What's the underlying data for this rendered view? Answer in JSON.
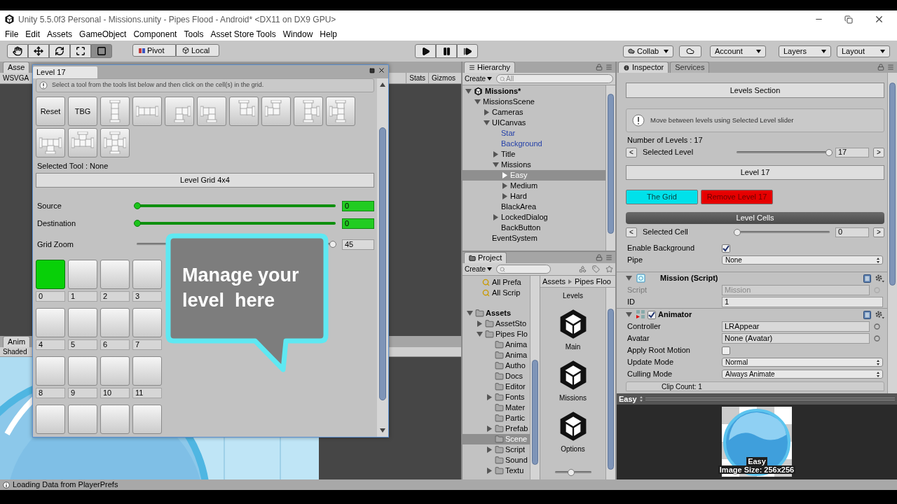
{
  "window": {
    "title": "Unity 5.5.0f3 Personal - Missions.unity - Pipes Flood - Android* <DX11 on DX9 GPU>"
  },
  "menu": [
    "File",
    "Edit",
    "Assets",
    "GameObject",
    "Component",
    "Tools",
    "Asset Store Tools",
    "Window",
    "Help"
  ],
  "toolbar": {
    "tools": [
      {
        "kind": "hand",
        "selected": false
      },
      {
        "kind": "move",
        "selected": false
      },
      {
        "kind": "rotate",
        "selected": false
      },
      {
        "kind": "scale",
        "selected": false
      },
      {
        "kind": "rect",
        "selected": true
      }
    ],
    "handles": [
      {
        "kind": "pivot",
        "label": "Pivot"
      },
      {
        "kind": "local",
        "label": "Local"
      }
    ],
    "playback": [
      {
        "kind": "play",
        "selected": false
      },
      {
        "kind": "pause",
        "selected": false
      },
      {
        "kind": "step",
        "selected": false
      }
    ],
    "right": [
      {
        "kind": "collab",
        "label": "Collab"
      },
      {
        "kind": "cloud"
      },
      {
        "kind": "dropdown",
        "label": "Account"
      },
      {
        "kind": "dropdown",
        "label": "Layers"
      },
      {
        "kind": "dropdown",
        "label": "Layout"
      }
    ]
  },
  "scene_panel": {
    "tab": "Asse",
    "resolution": "WSVGA",
    "buttons": [
      "Stats",
      "Gizmos"
    ]
  },
  "animation_panel": {
    "tab": "Anim",
    "mode": "Shaded"
  },
  "level_window": {
    "tab": "Level 17",
    "help": "Select a tool from the tools list below and then click on the cell(s) in the grid.",
    "tools": [
      {
        "kind": "text",
        "label": "Reset"
      },
      {
        "kind": "text",
        "label": "TBG"
      },
      {
        "kind": "pipe",
        "north": true,
        "east": false,
        "south": true,
        "west": false
      },
      {
        "kind": "pipe",
        "north": false,
        "east": true,
        "south": false,
        "west": true
      },
      {
        "kind": "pipe",
        "north": false,
        "east": true,
        "south": true,
        "west": false
      },
      {
        "kind": "pipe",
        "north": false,
        "east": false,
        "south": true,
        "west": true
      },
      {
        "kind": "pipe",
        "north": true,
        "east": true,
        "south": false,
        "west": false
      },
      {
        "kind": "pipe",
        "north": true,
        "east": false,
        "south": false,
        "west": true
      },
      {
        "kind": "pipe",
        "north": true,
        "east": true,
        "south": true,
        "west": false
      },
      {
        "kind": "pipe",
        "north": true,
        "east": false,
        "south": true,
        "west": true
      },
      {
        "kind": "pipe",
        "north": false,
        "east": true,
        "south": true,
        "west": true
      },
      {
        "kind": "pipe",
        "north": true,
        "east": true,
        "south": false,
        "west": true
      },
      {
        "kind": "pipe",
        "north": true,
        "east": true,
        "south": true,
        "west": true
      }
    ],
    "selected_tool": "Selected Tool : None",
    "grid_header": "Level Grid 4x4",
    "sliders": [
      {
        "label": "Source",
        "level": 0,
        "value": "0",
        "highlight": true
      },
      {
        "label": "Destination",
        "level": 0,
        "value": "0",
        "highlight": true
      },
      {
        "label": "Grid Zoom",
        "level": 0.99,
        "value": "45",
        "highlight": false
      }
    ],
    "cells": [
      {
        "label": "0",
        "filled": true
      },
      {
        "label": "1",
        "filled": false
      },
      {
        "label": "2",
        "filled": false
      },
      {
        "label": "3",
        "filled": false
      },
      {
        "label": "4",
        "filled": false
      },
      {
        "label": "5",
        "filled": false
      },
      {
        "label": "6",
        "filled": false
      },
      {
        "label": "7",
        "filled": false
      },
      {
        "label": "8",
        "filled": false
      },
      {
        "label": "9",
        "filled": false
      },
      {
        "label": "10",
        "filled": false
      },
      {
        "label": "11",
        "filled": false
      },
      {
        "filled": false
      },
      {
        "filled": false
      },
      {
        "filled": false
      },
      {
        "filled": false
      }
    ]
  },
  "callout": {
    "text": "Manage your level  here"
  },
  "hierarchy": {
    "tab": "Hierarchy",
    "create": "Create",
    "search_placeholder": "All",
    "tree": [
      {
        "name": "Missions*",
        "kind": "scene",
        "expanded": true,
        "selected": false,
        "prefab": false,
        "children": [
          {
            "name": "MissionsScene",
            "expanded": true,
            "selected": false,
            "prefab": false,
            "children": [
              {
                "name": "Cameras",
                "expanded": false,
                "selected": false,
                "prefab": false
              },
              {
                "name": "UICanvas",
                "expanded": true,
                "selected": false,
                "prefab": false,
                "children": [
                  {
                    "name": "Star",
                    "selected": false,
                    "prefab": true
                  },
                  {
                    "name": "Background",
                    "selected": false,
                    "prefab": true
                  },
                  {
                    "name": "Title",
                    "expanded": false,
                    "selected": false,
                    "prefab": false
                  },
                  {
                    "name": "Missions",
                    "expanded": true,
                    "selected": false,
                    "prefab": false,
                    "children": [
                      {
                        "name": "Easy",
                        "expanded": false,
                        "selected": true,
                        "prefab": false
                      },
                      {
                        "name": "Medium",
                        "expanded": false,
                        "selected": false,
                        "prefab": false
                      },
                      {
                        "name": "Hard",
                        "expanded": false,
                        "selected": false,
                        "prefab": false
                      }
                    ]
                  },
                  {
                    "name": "BlackArea",
                    "selected": false,
                    "prefab": false
                  },
                  {
                    "name": "LockedDialog",
                    "expanded": false,
                    "selected": false,
                    "prefab": false
                  },
                  {
                    "name": "BackButton",
                    "selected": false,
                    "prefab": false
                  }
                ]
              },
              {
                "name": "EventSystem",
                "selected": false,
                "prefab": false
              }
            ]
          }
        ]
      }
    ]
  },
  "project": {
    "tab": "Project",
    "create": "Create",
    "favorites": [
      "All Prefa",
      "All Scrip"
    ],
    "tree": [
      {
        "name": "Assets",
        "expanded": true,
        "selected": false,
        "children": [
          {
            "name": "AssetSto",
            "expanded": false,
            "selected": false
          },
          {
            "name": "Pipes Flo",
            "expanded": true,
            "selected": false,
            "children": [
              {
                "name": "Anima",
                "selected": false
              },
              {
                "name": "Anima",
                "selected": false
              },
              {
                "name": "Autho",
                "selected": false
              },
              {
                "name": "Docs",
                "selected": false
              },
              {
                "name": "Editor",
                "selected": false
              },
              {
                "name": "Fonts",
                "expanded": false,
                "selected": false
              },
              {
                "name": "Mater",
                "selected": false
              },
              {
                "name": "Partic",
                "selected": false
              },
              {
                "name": "Prefab",
                "expanded": false,
                "selected": false
              },
              {
                "name": "Scene",
                "selected": true
              },
              {
                "name": "Script",
                "expanded": false,
                "selected": false
              },
              {
                "name": "Sound",
                "selected": false
              },
              {
                "name": "Textu",
                "expanded": false,
                "selected": false
              }
            ]
          }
        ]
      }
    ],
    "breadcrumb": [
      "Assets",
      "Pipes Floo"
    ],
    "assets": [
      {
        "label": "Levels",
        "kind": "cut"
      },
      {
        "label": "Main",
        "kind": "scene"
      },
      {
        "label": "Missions",
        "kind": "scene"
      },
      {
        "label": "Options",
        "kind": "scene"
      }
    ]
  },
  "inspector": {
    "tabs": [
      {
        "label": "Inspector",
        "selected": true
      },
      {
        "label": "Services",
        "selected": false
      }
    ],
    "section_header": "Levels Section",
    "help": "Move between levels using Selected Level slider",
    "levels_count": "Number of Levels : 17",
    "selected_level": {
      "prev": "<",
      "label": "Selected Level",
      "level": 1,
      "value": "17",
      "next": ">"
    },
    "level_header": "Level 17",
    "actions": [
      {
        "label": "The Grid",
        "color": "#00e1ea"
      },
      {
        "label": "Remove Level 17",
        "color": "#e60000"
      }
    ],
    "cells_header": "Level Cells",
    "selected_cell": {
      "prev": "<",
      "label": "Selected Cell",
      "level": 0,
      "value": "0",
      "next": ">"
    },
    "cell_fields": [
      {
        "kind": "checkbox",
        "label": "Enable Background",
        "checked": true
      },
      {
        "kind": "dropdown",
        "label": "Pipe",
        "value": "None"
      }
    ],
    "components": [
      {
        "title": "Mission (Script)",
        "kind": "script",
        "expanded": true,
        "fields": [
          {
            "kind": "object",
            "label": "Script",
            "value": "Mission",
            "disabled": true
          },
          {
            "kind": "text",
            "label": "ID",
            "value": "1",
            "disabled": false
          }
        ]
      },
      {
        "title": "Animator",
        "kind": "animator",
        "expanded": true,
        "enabled": true,
        "fields": [
          {
            "kind": "object",
            "label": "Controller",
            "value": "LRAppear",
            "disabled": false
          },
          {
            "kind": "object",
            "label": "Avatar",
            "value": "None (Avatar)",
            "disabled": false
          },
          {
            "kind": "checkbox",
            "label": "Apply Root Motion",
            "checked": false
          },
          {
            "kind": "dropdown",
            "label": "Update Mode",
            "value": "Normal"
          },
          {
            "kind": "dropdown",
            "label": "Culling Mode",
            "value": "Always Animate"
          }
        ],
        "note": "Clip Count: 1"
      }
    ],
    "preview": {
      "title": "Easy",
      "name": "Easy",
      "size": "Image Size: 256x256"
    }
  },
  "status_bar": {
    "text": "Loading Data from PlayerPrefs"
  }
}
